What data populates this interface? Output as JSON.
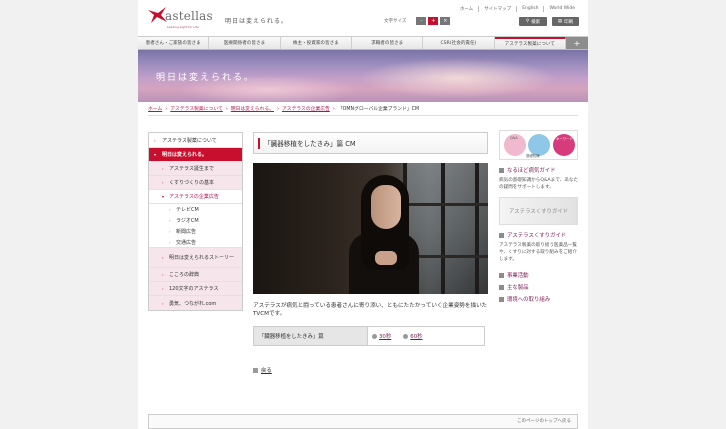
{
  "header": {
    "brand": "astellas",
    "tagline": "Leading Light for Life",
    "slogan": "明日は変えられる。",
    "toplinks": [
      "ホーム",
      "サイトマップ",
      "English",
      "World Wide"
    ],
    "textsize_label": "文字サイズ",
    "textsize_buttons": [
      "-",
      "+",
      "×"
    ],
    "search_label": "検索",
    "print_label": "印刷"
  },
  "gnav": {
    "items": [
      "患者さん・ご家族の皆さま",
      "医療関係者の皆さま",
      "株主・投資家の皆さま",
      "求職者の皆さま",
      "CSR(社会的責任)",
      "アステラス製薬について"
    ],
    "plus": "+"
  },
  "banner": {
    "text": "明日は変えられる。"
  },
  "breadcrumb": {
    "items": [
      "ホーム",
      "アステラス製薬について",
      "明日は変えられる。",
      "アステラスの企業広告"
    ],
    "current": "「OMNグローバル企業ブランド」CM"
  },
  "lnav": {
    "head": "アステラス製薬について",
    "active": "明日は変えられる。",
    "items": [
      "アステラス誕生まで",
      "くすりづくりの基本",
      "アステラスの企業広告"
    ],
    "subitems": [
      "テレビCM",
      "ラジオCM",
      "新聞広告",
      "交通広告"
    ],
    "pink_items": [
      "明日は変えられるストーリー",
      "こころの辞典",
      "120文字のアステラス",
      "勇気、つながれ.com"
    ]
  },
  "main": {
    "title": "「臓器移植をしたきみ」篇 CM",
    "description": "アステラスが病気と闘っている患者さんに寄り添い、ともにたたかっていく企業姿勢を描いたTVCMです。",
    "table_header": "「臓器移植をしたきみ」篇",
    "table_links": [
      "30秒",
      "60秒"
    ],
    "back": "戻る"
  },
  "right": {
    "qa_labels": [
      "Q&A",
      "キーワード",
      "基礎知識"
    ],
    "link1": "なるほど病気ガイド",
    "text1": "病気の基礎知識からQ&Aまで、あなたの疑問をサポートします。",
    "guide_banner": "アステラスくすりガイド",
    "link2": "アステラスくすりガイド",
    "text2": "アステラス製薬の取り扱う医薬品一覧や、くすりに対する取り組みをご紹介します。",
    "links": [
      "事業活動",
      "主な製品",
      "環境への取り組み"
    ]
  },
  "footer": {
    "pagetop": "このページのトップへ戻る"
  },
  "colors": {
    "accent": "#c8102e",
    "link": "#7a1a55"
  }
}
